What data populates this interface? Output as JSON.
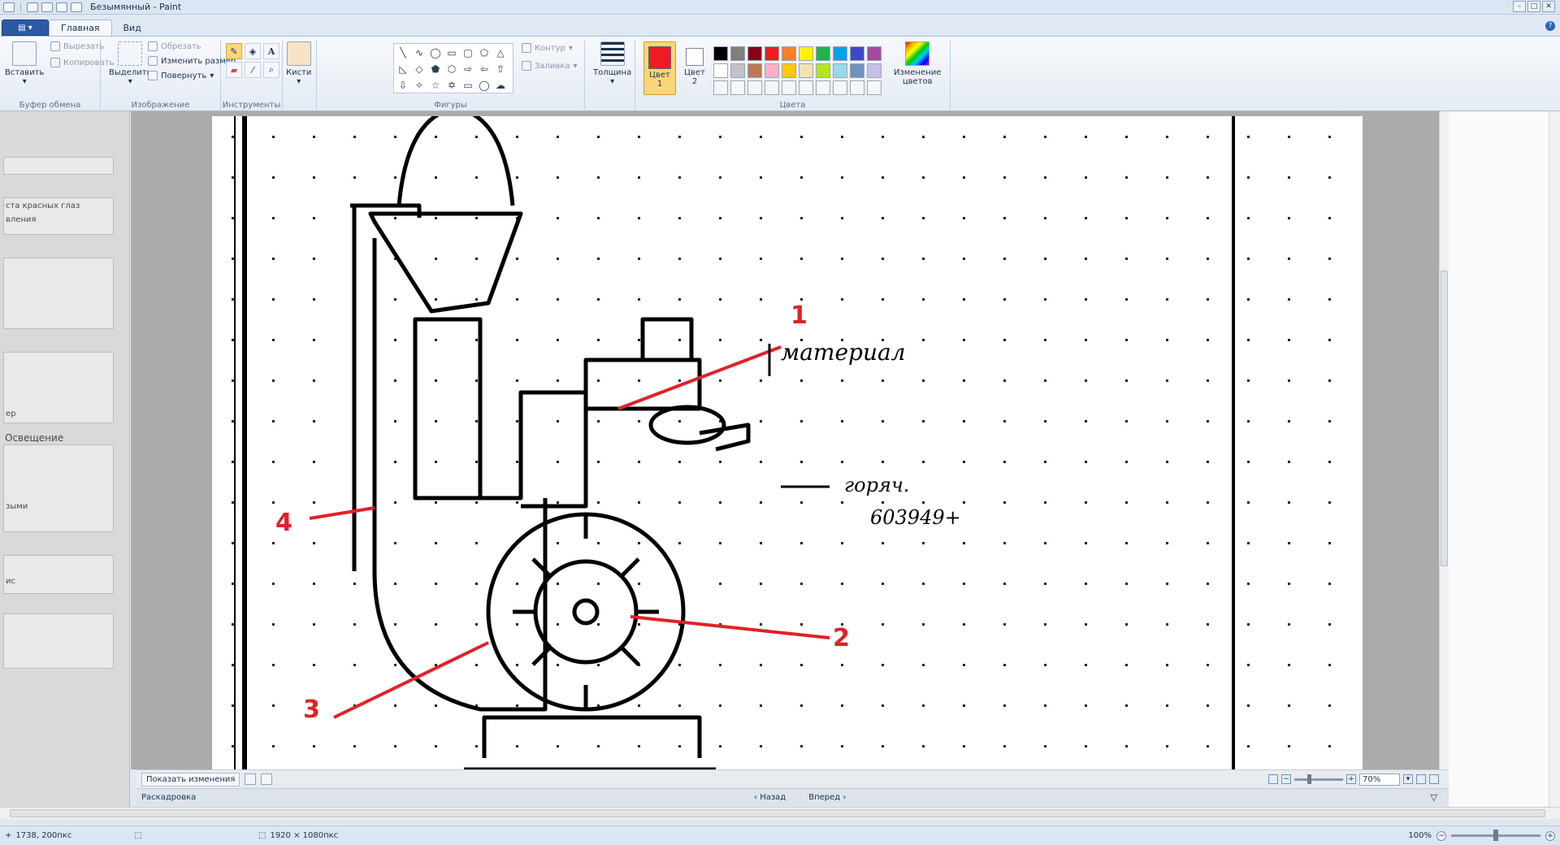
{
  "window": {
    "title": "Безымянный - Paint"
  },
  "tabs": [
    {
      "label": "Главная"
    },
    {
      "label": "Вид"
    }
  ],
  "ribbon": {
    "clipboard": {
      "paste": "Вставить",
      "cut": "Вырезать",
      "copy": "Копировать",
      "group": "Буфер обмена"
    },
    "image": {
      "select": "Выделить",
      "crop": "Обрезать",
      "resize": "Изменить размер",
      "rotate": "Повернуть",
      "group": "Изображение"
    },
    "tools": {
      "group": "Инструменты"
    },
    "brushes": {
      "label": "Кисти"
    },
    "shapes": {
      "outline": "Контур",
      "fill": "Заливка",
      "group": "Фигуры"
    },
    "size": {
      "label": "Толщина"
    },
    "colors": {
      "color1": "Цвет",
      "color1_num": "1",
      "color2": "Цвет",
      "color2_num": "2",
      "edit": "Изменение",
      "edit2": "цветов",
      "group": "Цвета",
      "color1_value": "#ed1c24",
      "color2_value": "#ffffff",
      "row1": [
        "#000000",
        "#7f7f7f",
        "#880015",
        "#ed1c24",
        "#ff7f27",
        "#fff200",
        "#22b14c",
        "#00a2e8",
        "#3f48cc",
        "#a349a4"
      ],
      "row2": [
        "#ffffff",
        "#c3c3c3",
        "#b97a57",
        "#ffaec9",
        "#ffc90e",
        "#efe4b0",
        "#b5e61d",
        "#99d9ea",
        "#7092be",
        "#c8bfe7"
      ]
    }
  },
  "left_panel": {
    "item1_a": "ста красных глаз",
    "item1_b": "вления",
    "item2": "ер",
    "heading": "Освещение",
    "item3": "зыми",
    "item4": "ис"
  },
  "drawing": {
    "label1": "1",
    "label2": "2",
    "label3": "3",
    "label4": "4",
    "note_material": "материал",
    "note_fuel1": "горяч.",
    "note_fuel2": "603949+"
  },
  "storyboard": {
    "show_changes": "Показать изменения",
    "zoom_value": "70%",
    "label": "Раскадровка",
    "back": "Назад",
    "forward": "Вперед"
  },
  "status": {
    "cursor": "1738, 200пкс",
    "size": "1920 × 1080пкс",
    "zoom": "100%"
  }
}
